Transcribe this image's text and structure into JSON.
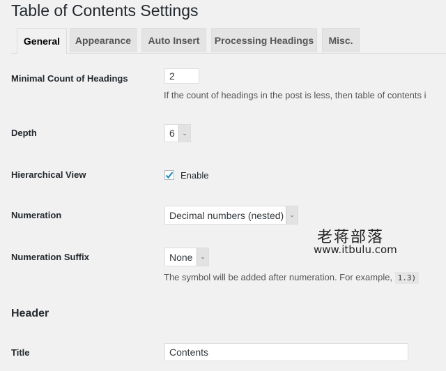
{
  "page": {
    "title": "Table of Contents Settings"
  },
  "tabs": [
    {
      "label": "General",
      "active": true
    },
    {
      "label": "Appearance",
      "active": false
    },
    {
      "label": "Auto Insert",
      "active": false
    },
    {
      "label": "Processing Headings",
      "active": false
    },
    {
      "label": "Misc.",
      "active": false
    }
  ],
  "fields": {
    "min_count": {
      "label": "Minimal Count of Headings",
      "value": "2",
      "description": "If the count of headings in the post is less, then table of contents i"
    },
    "depth": {
      "label": "Depth",
      "value": "6"
    },
    "hierarchical": {
      "label": "Hierarchical View",
      "checkbox_label": "Enable",
      "checked": true
    },
    "numeration": {
      "label": "Numeration",
      "value": "Decimal numbers (nested)"
    },
    "numeration_suffix": {
      "label": "Numeration Suffix",
      "value": "None",
      "description": "The symbol will be added after numeration. For example,",
      "example_code": "1.3)"
    }
  },
  "header_section": {
    "heading": "Header",
    "title_field": {
      "label": "Title",
      "value": "Contents"
    }
  },
  "watermark": {
    "chinese": "老蒋部落",
    "url": "www.itbulu.com"
  },
  "colors": {
    "checkmark": "#1e8cbe",
    "background": "#f1f1f1"
  }
}
